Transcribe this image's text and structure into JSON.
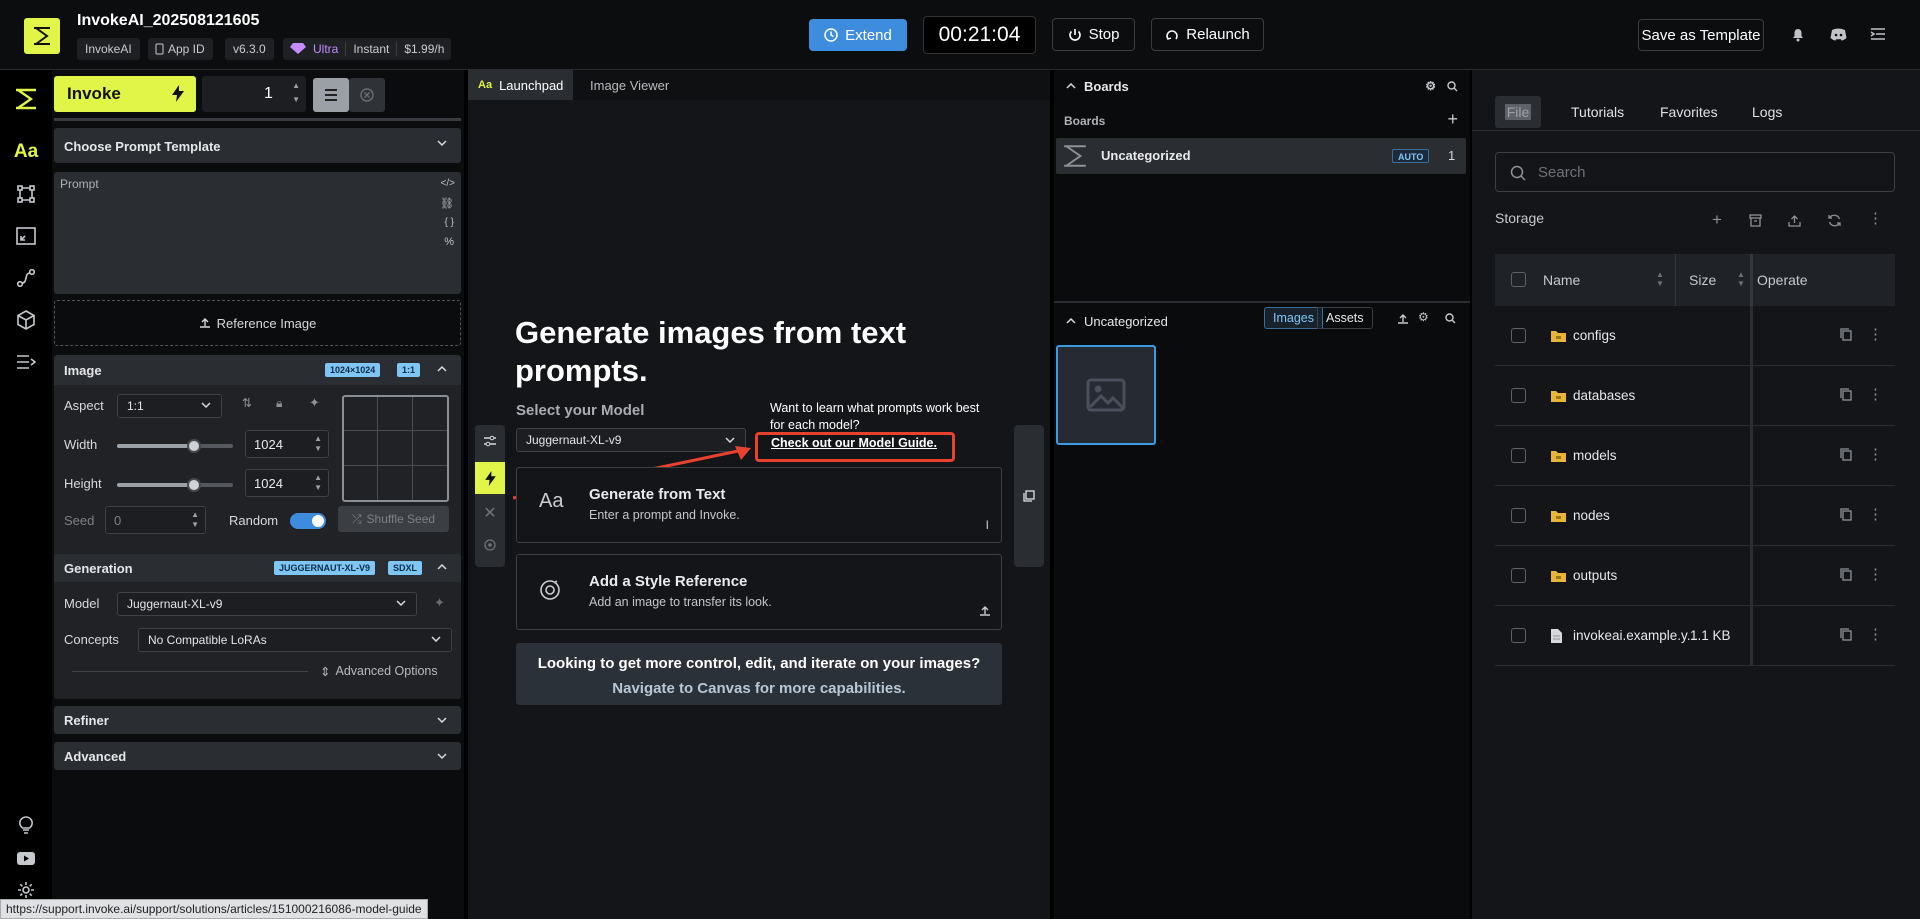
{
  "app": {
    "title": "InvokeAI_202508121605",
    "chips": [
      "InvokeAI",
      "App ID",
      "v6.3.0"
    ],
    "tier": "Ultra",
    "mode": "Instant",
    "price": "$1.99/h",
    "extend_label": "Extend",
    "timer": "00:21:04",
    "stop_label": "Stop",
    "relaunch_label": "Relaunch",
    "save_template_label": "Save as Template"
  },
  "params": {
    "invoke_label": "Invoke",
    "quantity": "1",
    "prompt_template_label": "Choose Prompt Template",
    "prompt_label": "Prompt",
    "reference_image_label": "Reference Image",
    "image": {
      "title": "Image",
      "size_badge": "1024×1024",
      "ratio_badge": "1:1",
      "aspect_label": "Aspect",
      "aspect_value": "1:1",
      "width_label": "Width",
      "width_value": "1024",
      "width_fraction": 0.66,
      "height_label": "Height",
      "height_value": "1024",
      "height_fraction": 0.66,
      "seed_label": "Seed",
      "seed_value": "0",
      "random_label": "Random",
      "random_on": true,
      "shuffle_label": "Shuffle Seed"
    },
    "generation": {
      "title": "Generation",
      "model_badge": "JUGGERNAUT-XL-V9",
      "base_badge": "SDXL",
      "model_label": "Model",
      "model_value": "Juggernaut-XL-v9",
      "concepts_label": "Concepts",
      "concepts_value": "No Compatible LoRAs",
      "advanced_options_label": "Advanced Options"
    },
    "refiner_label": "Refiner",
    "advanced_label": "Advanced"
  },
  "center": {
    "tabs": [
      "Launchpad",
      "Image Viewer"
    ],
    "title": "Generate images from text prompts.",
    "select_model_label": "Select your Model",
    "model_value": "Juggernaut-XL-v9",
    "help_text": "Want to learn what prompts work best for each model?",
    "guide_link": "Check out our Model Guide.",
    "cards": [
      {
        "title": "Generate from Text",
        "subtitle": "Enter a prompt and Invoke."
      },
      {
        "title": "Add a Style Reference",
        "subtitle": "Add an image to transfer its look."
      }
    ],
    "cta_line1": "Looking to get more control, edit, and iterate on your images?",
    "cta_line2": "Navigate to Canvas for more capabilities."
  },
  "boards": {
    "header": "Boards",
    "list_label": "Boards",
    "board_name": "Uncategorized",
    "auto_badge": "AUTO",
    "board_count": "1",
    "gallery_header": "Uncategorized",
    "images_label": "Images",
    "assets_label": "Assets"
  },
  "files": {
    "tabs": [
      "File",
      "Tutorials",
      "Favorites",
      "Logs"
    ],
    "search_placeholder": "Search",
    "storage_label": "Storage",
    "columns": [
      "Name",
      "Size",
      "Operate"
    ],
    "rows": [
      {
        "name": "configs",
        "size": "",
        "type": "folder"
      },
      {
        "name": "databases",
        "size": "",
        "type": "folder"
      },
      {
        "name": "models",
        "size": "",
        "type": "folder"
      },
      {
        "name": "nodes",
        "size": "",
        "type": "folder"
      },
      {
        "name": "outputs",
        "size": "",
        "type": "folder"
      },
      {
        "name": "invokeai.example.y...",
        "size": "1.1 KB",
        "type": "file"
      }
    ]
  },
  "status_url": "https://support.invoke.ai/support/solutions/articles/151000216086-model-guide",
  "colors": {
    "accent": "#e0f547",
    "primary": "#3d8cdd",
    "highlight": "#e8412e"
  }
}
